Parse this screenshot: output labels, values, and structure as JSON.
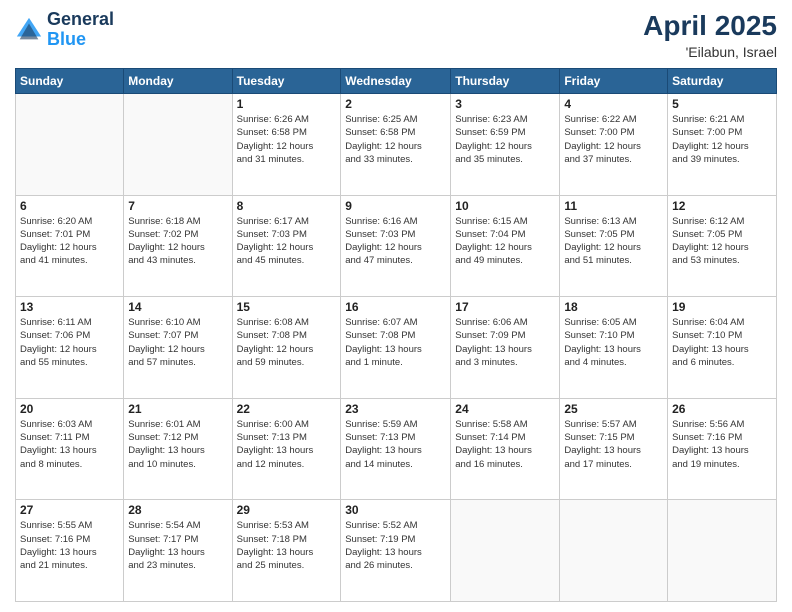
{
  "logo": {
    "line1": "General",
    "line2": "Blue"
  },
  "title": "April 2025",
  "location": "'Eilabun, Israel",
  "days_of_week": [
    "Sunday",
    "Monday",
    "Tuesday",
    "Wednesday",
    "Thursday",
    "Friday",
    "Saturday"
  ],
  "weeks": [
    [
      {
        "day": "",
        "info": ""
      },
      {
        "day": "",
        "info": ""
      },
      {
        "day": "1",
        "info": "Sunrise: 6:26 AM\nSunset: 6:58 PM\nDaylight: 12 hours\nand 31 minutes."
      },
      {
        "day": "2",
        "info": "Sunrise: 6:25 AM\nSunset: 6:58 PM\nDaylight: 12 hours\nand 33 minutes."
      },
      {
        "day": "3",
        "info": "Sunrise: 6:23 AM\nSunset: 6:59 PM\nDaylight: 12 hours\nand 35 minutes."
      },
      {
        "day": "4",
        "info": "Sunrise: 6:22 AM\nSunset: 7:00 PM\nDaylight: 12 hours\nand 37 minutes."
      },
      {
        "day": "5",
        "info": "Sunrise: 6:21 AM\nSunset: 7:00 PM\nDaylight: 12 hours\nand 39 minutes."
      }
    ],
    [
      {
        "day": "6",
        "info": "Sunrise: 6:20 AM\nSunset: 7:01 PM\nDaylight: 12 hours\nand 41 minutes."
      },
      {
        "day": "7",
        "info": "Sunrise: 6:18 AM\nSunset: 7:02 PM\nDaylight: 12 hours\nand 43 minutes."
      },
      {
        "day": "8",
        "info": "Sunrise: 6:17 AM\nSunset: 7:03 PM\nDaylight: 12 hours\nand 45 minutes."
      },
      {
        "day": "9",
        "info": "Sunrise: 6:16 AM\nSunset: 7:03 PM\nDaylight: 12 hours\nand 47 minutes."
      },
      {
        "day": "10",
        "info": "Sunrise: 6:15 AM\nSunset: 7:04 PM\nDaylight: 12 hours\nand 49 minutes."
      },
      {
        "day": "11",
        "info": "Sunrise: 6:13 AM\nSunset: 7:05 PM\nDaylight: 12 hours\nand 51 minutes."
      },
      {
        "day": "12",
        "info": "Sunrise: 6:12 AM\nSunset: 7:05 PM\nDaylight: 12 hours\nand 53 minutes."
      }
    ],
    [
      {
        "day": "13",
        "info": "Sunrise: 6:11 AM\nSunset: 7:06 PM\nDaylight: 12 hours\nand 55 minutes."
      },
      {
        "day": "14",
        "info": "Sunrise: 6:10 AM\nSunset: 7:07 PM\nDaylight: 12 hours\nand 57 minutes."
      },
      {
        "day": "15",
        "info": "Sunrise: 6:08 AM\nSunset: 7:08 PM\nDaylight: 12 hours\nand 59 minutes."
      },
      {
        "day": "16",
        "info": "Sunrise: 6:07 AM\nSunset: 7:08 PM\nDaylight: 13 hours\nand 1 minute."
      },
      {
        "day": "17",
        "info": "Sunrise: 6:06 AM\nSunset: 7:09 PM\nDaylight: 13 hours\nand 3 minutes."
      },
      {
        "day": "18",
        "info": "Sunrise: 6:05 AM\nSunset: 7:10 PM\nDaylight: 13 hours\nand 4 minutes."
      },
      {
        "day": "19",
        "info": "Sunrise: 6:04 AM\nSunset: 7:10 PM\nDaylight: 13 hours\nand 6 minutes."
      }
    ],
    [
      {
        "day": "20",
        "info": "Sunrise: 6:03 AM\nSunset: 7:11 PM\nDaylight: 13 hours\nand 8 minutes."
      },
      {
        "day": "21",
        "info": "Sunrise: 6:01 AM\nSunset: 7:12 PM\nDaylight: 13 hours\nand 10 minutes."
      },
      {
        "day": "22",
        "info": "Sunrise: 6:00 AM\nSunset: 7:13 PM\nDaylight: 13 hours\nand 12 minutes."
      },
      {
        "day": "23",
        "info": "Sunrise: 5:59 AM\nSunset: 7:13 PM\nDaylight: 13 hours\nand 14 minutes."
      },
      {
        "day": "24",
        "info": "Sunrise: 5:58 AM\nSunset: 7:14 PM\nDaylight: 13 hours\nand 16 minutes."
      },
      {
        "day": "25",
        "info": "Sunrise: 5:57 AM\nSunset: 7:15 PM\nDaylight: 13 hours\nand 17 minutes."
      },
      {
        "day": "26",
        "info": "Sunrise: 5:56 AM\nSunset: 7:16 PM\nDaylight: 13 hours\nand 19 minutes."
      }
    ],
    [
      {
        "day": "27",
        "info": "Sunrise: 5:55 AM\nSunset: 7:16 PM\nDaylight: 13 hours\nand 21 minutes."
      },
      {
        "day": "28",
        "info": "Sunrise: 5:54 AM\nSunset: 7:17 PM\nDaylight: 13 hours\nand 23 minutes."
      },
      {
        "day": "29",
        "info": "Sunrise: 5:53 AM\nSunset: 7:18 PM\nDaylight: 13 hours\nand 25 minutes."
      },
      {
        "day": "30",
        "info": "Sunrise: 5:52 AM\nSunset: 7:19 PM\nDaylight: 13 hours\nand 26 minutes."
      },
      {
        "day": "",
        "info": ""
      },
      {
        "day": "",
        "info": ""
      },
      {
        "day": "",
        "info": ""
      }
    ]
  ]
}
